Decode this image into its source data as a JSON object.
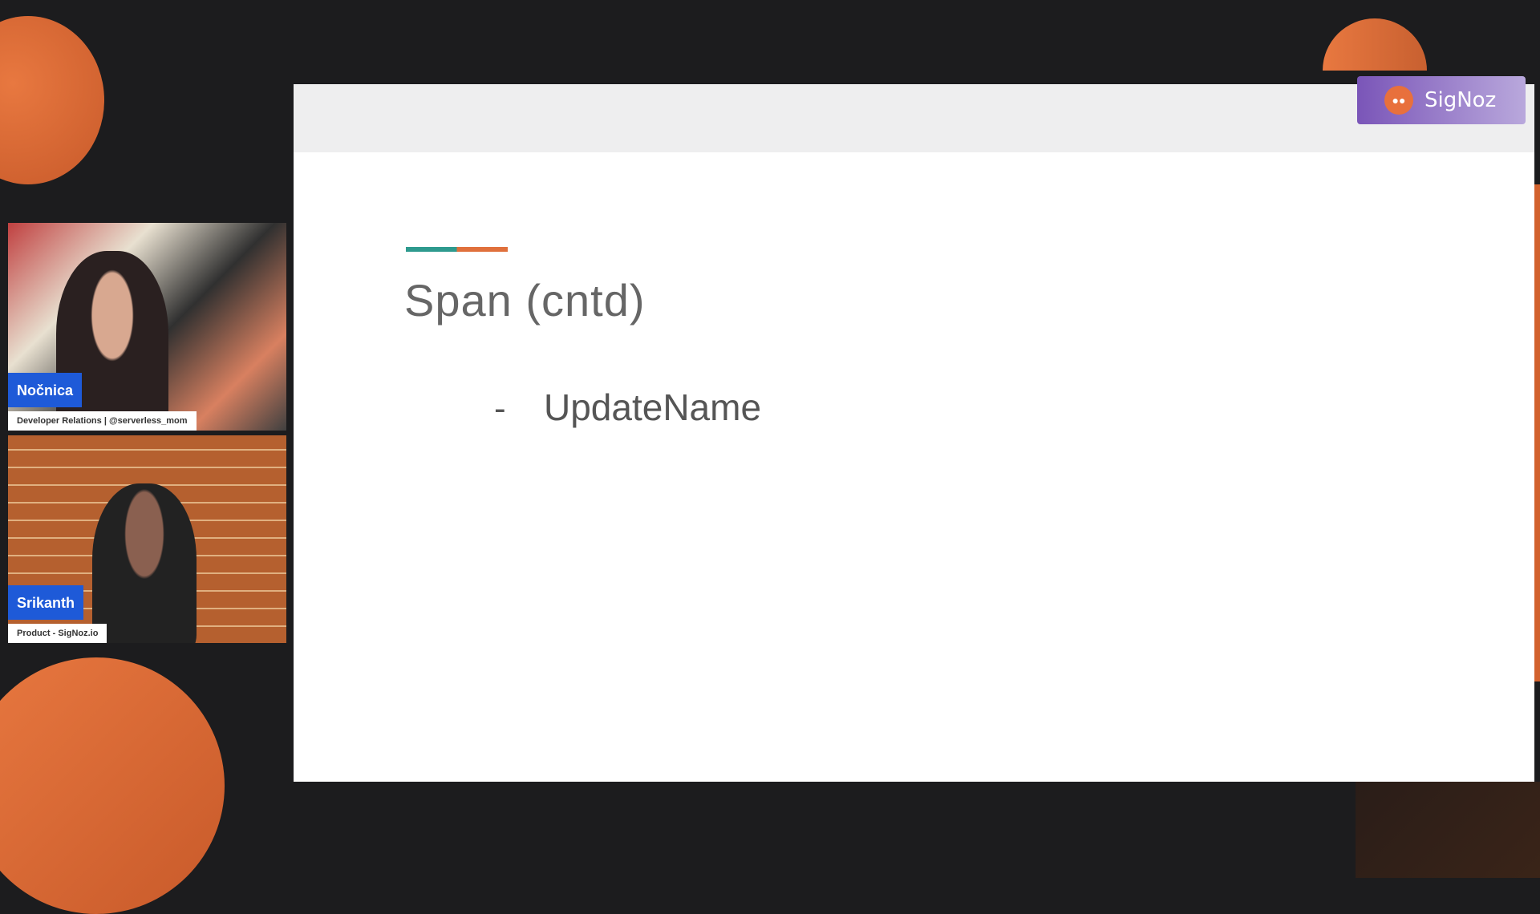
{
  "slide": {
    "title": "Span (cntd)",
    "bullet_marker": "-",
    "bullet": "UpdateName"
  },
  "badge": {
    "label": "SigNoz"
  },
  "participants": [
    {
      "name": "Nočnica",
      "subtitle": "Developer Relations | @serverless_mom"
    },
    {
      "name": "Srikanth",
      "subtitle": "Product - SigNoz.io"
    }
  ],
  "colors": {
    "accent_teal": "#2e9a8e",
    "accent_orange": "#e0703c",
    "name_tag": "#1e5ad8",
    "badge": "#7a55b8"
  }
}
